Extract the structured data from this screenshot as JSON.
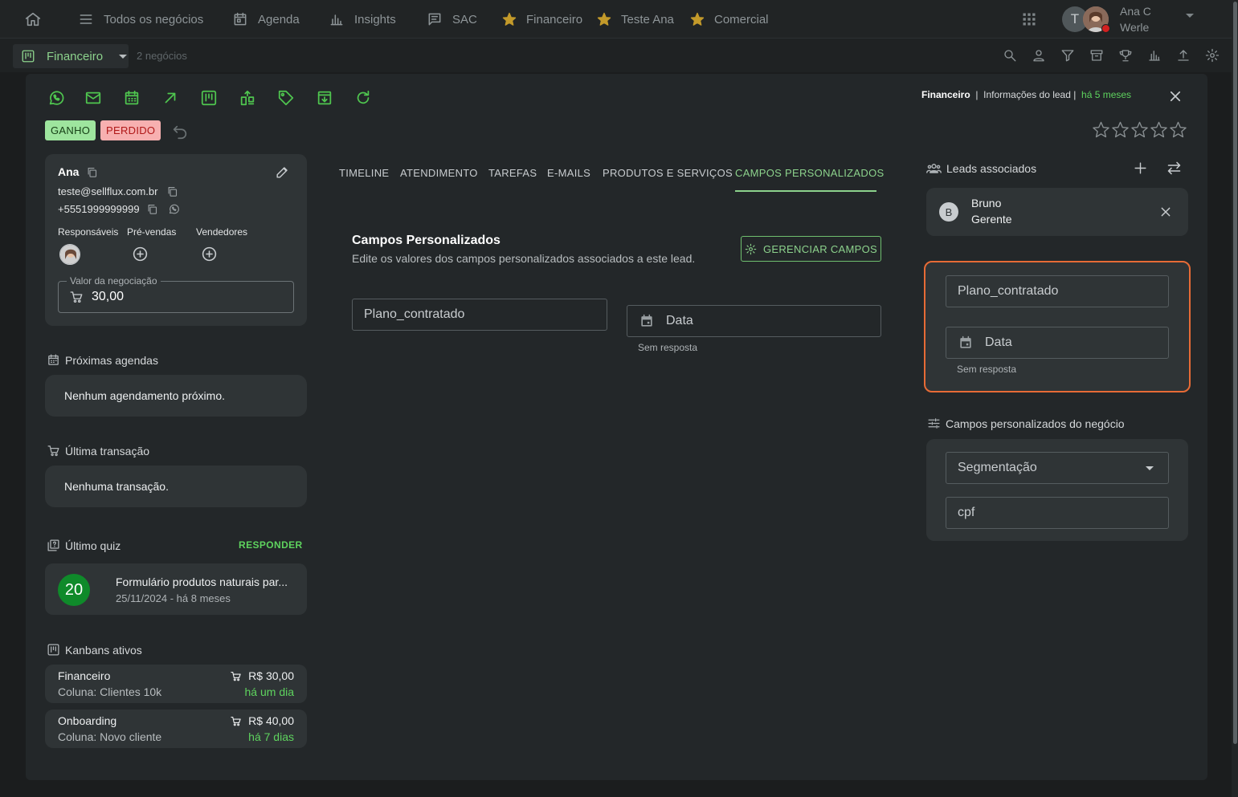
{
  "nav": {
    "items": [
      {
        "label": "Todos os negócios",
        "icon": "list-icon"
      },
      {
        "label": "Agenda",
        "icon": "calendar-icon"
      },
      {
        "label": "Insights",
        "icon": "bar-chart-icon"
      },
      {
        "label": "SAC",
        "icon": "chat-icon"
      },
      {
        "label": "Financeiro",
        "icon": "star-icon"
      },
      {
        "label": "Teste Ana",
        "icon": "star-icon"
      },
      {
        "label": "Comercial",
        "icon": "star-icon"
      }
    ],
    "avatar_letter": "T",
    "user_name": "Ana C Werle"
  },
  "subbar": {
    "pipeline": "Financeiro",
    "count": "2 negócios"
  },
  "modal": {
    "header": {
      "pipeline": "Financeiro",
      "separator": "|",
      "info": "Informações do lead |",
      "time": "há 5 meses"
    },
    "badges": {
      "won": "GANHO",
      "lost": "PERDIDO"
    },
    "lead": {
      "name": "Ana",
      "email": "teste@sellflux.com.br",
      "phone": "+5551999999999",
      "roles": [
        "Responsáveis",
        "Pré-vendas",
        "Vendedores"
      ],
      "value_label": "Valor da negociação",
      "value": "30,00"
    },
    "agenda": {
      "title": "Próximas agendas",
      "empty": "Nenhum agendamento próximo."
    },
    "transaction": {
      "title": "Última transação",
      "empty": "Nenhuma transação."
    },
    "quiz": {
      "title": "Último quiz",
      "action": "RESPONDER",
      "score": "20",
      "name": "Formulário produtos naturais par...",
      "date": "25/11/2024 - há 8 meses"
    },
    "kanbans": {
      "title": "Kanbans ativos",
      "items": [
        {
          "name": "Financeiro",
          "column": "Coluna: Clientes 10k",
          "value": "R$ 30,00",
          "time": "há um dia"
        },
        {
          "name": "Onboarding",
          "column": "Coluna: Novo cliente",
          "value": "R$ 40,00",
          "time": "há 7 dias"
        }
      ]
    },
    "tabs": [
      "TIMELINE",
      "ATENDIMENTO",
      "TAREFAS",
      "E-MAILS",
      "PRODUTOS E SERVIÇOS",
      "CAMPOS PERSONALIZADOS"
    ],
    "active_tab": "CAMPOS PERSONALIZADOS",
    "custom_fields": {
      "title": "Campos Personalizados",
      "subtitle": "Edite os valores dos campos personalizados associados a este lead.",
      "manage_button": "GERENCIAR CAMPOS",
      "field_plan": "Plano_contratado",
      "field_date": "Data",
      "no_answer": "Sem resposta"
    },
    "associated": {
      "title": "Leads associados",
      "lead_initial": "B",
      "lead_name": "Bruno",
      "lead_role": "Gerente"
    },
    "business_fields": {
      "title": "Campos personalizados do negócio",
      "segment": "Segmentação",
      "cpf": "cpf"
    },
    "rating_stars": 5
  },
  "colors": {
    "accent": "#8cd28c",
    "won_bg": "#9ee59e",
    "lost_bg": "#f7b0b0",
    "highlight": "#e76b36",
    "star": "#c39a2a"
  }
}
